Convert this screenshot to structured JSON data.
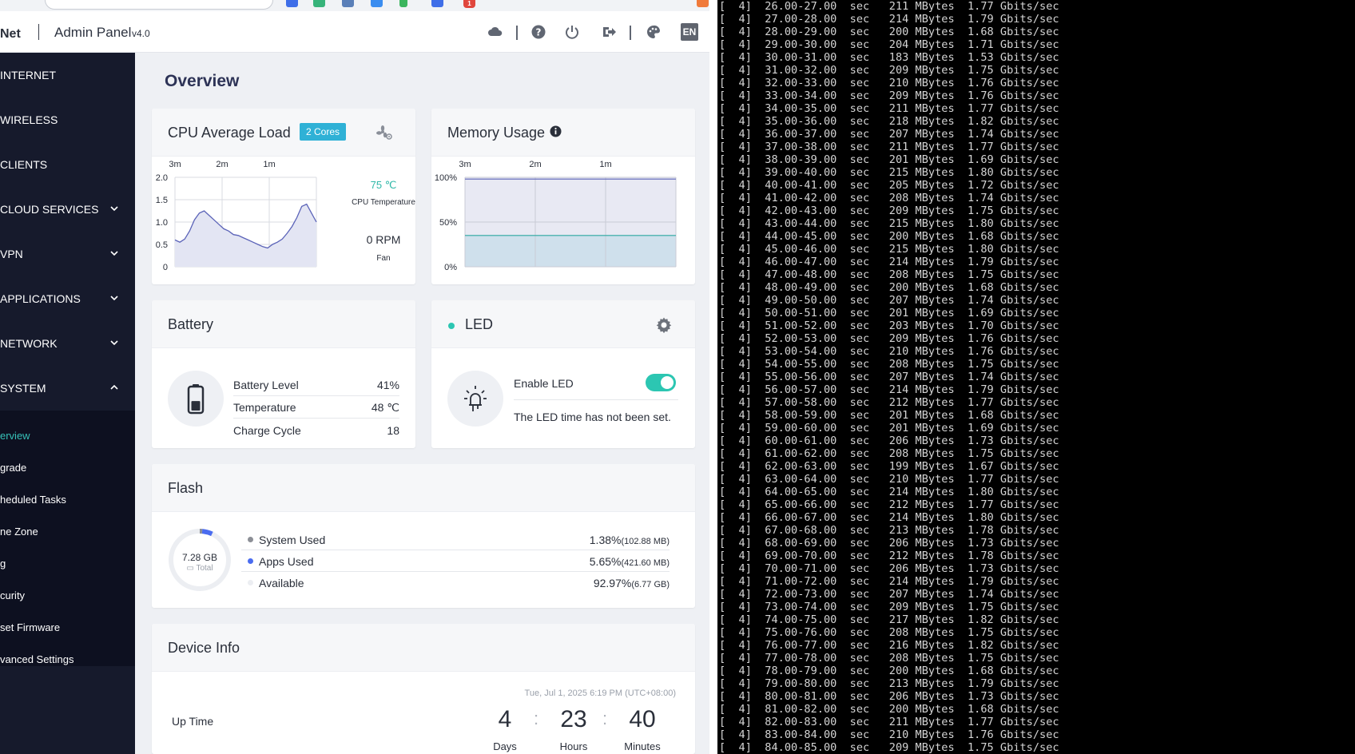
{
  "header": {
    "brand": "Net",
    "title": "Admin Panel",
    "version": "v4.0",
    "lang": "EN"
  },
  "sidebar": {
    "items": [
      {
        "label": "INTERNET",
        "expandable": false
      },
      {
        "label": "WIRELESS",
        "expandable": false
      },
      {
        "label": "CLIENTS",
        "expandable": false
      },
      {
        "label": "CLOUD SERVICES",
        "expandable": true
      },
      {
        "label": "VPN",
        "expandable": true
      },
      {
        "label": "APPLICATIONS",
        "expandable": true
      },
      {
        "label": "NETWORK",
        "expandable": true
      },
      {
        "label": "SYSTEM",
        "expandable": true
      }
    ],
    "system_submenu": [
      "erview",
      "grade",
      "heduled Tasks",
      "ne Zone",
      "g",
      "curity",
      "set Firmware",
      "vanced Settings"
    ],
    "active_submenu": "erview"
  },
  "main": {
    "title": "Overview",
    "cpu": {
      "title": "CPU Average Load",
      "cores_badge": "2 Cores",
      "temperature": "75 ℃",
      "temperature_label": "CPU Temperature",
      "fan_speed": "0 RPM",
      "fan_label": "Fan"
    },
    "memory": {
      "title": "Memory Usage"
    },
    "battery": {
      "title": "Battery",
      "rows": [
        {
          "label": "Battery Level",
          "value": "41%"
        },
        {
          "label": "Temperature",
          "value": "48 ℃"
        },
        {
          "label": "Charge Cycle",
          "value": "18"
        }
      ]
    },
    "led": {
      "title": "LED",
      "enable_label": "Enable LED",
      "enabled": true,
      "status": "The LED time has not been set."
    },
    "flash": {
      "title": "Flash",
      "total": "7.28 GB",
      "total_label": "Total",
      "rows": [
        {
          "label": "System Used",
          "percent": "1.38%",
          "size": "(102.88 MB)",
          "color": "#8c8f96"
        },
        {
          "label": "Apps Used",
          "percent": "5.65%",
          "size": "(421.60 MB)",
          "color": "#4a6cf0"
        },
        {
          "label": "Available",
          "percent": "92.97%",
          "size": "(6.77 GB)",
          "color": "#eceef2"
        }
      ]
    },
    "device_info": {
      "title": "Device Info",
      "date": "Tue, Jul 1, 2025 6:19 PM (UTC+08:00)",
      "uptime_label": "Up Time",
      "days": "4",
      "days_label": "Days",
      "hours": "23",
      "hours_label": "Hours",
      "minutes": "40",
      "minutes_label": "Minutes"
    }
  },
  "chart_data": [
    {
      "type": "area",
      "title": "CPU Average Load",
      "x_ticks": [
        "3m",
        "2m",
        "1m"
      ],
      "y_ticks": [
        "2.0",
        "1.5",
        "1.0",
        "0.5",
        "0"
      ],
      "ylim": [
        0,
        2.0
      ],
      "grid": true,
      "series": [
        {
          "values": [
            0.6,
            0.55,
            0.62,
            0.8,
            1.05,
            1.2,
            1.25,
            1.15,
            1.05,
            0.95,
            0.85,
            0.8,
            0.72,
            0.7,
            0.65,
            0.6,
            0.55,
            0.5,
            0.45,
            0.42,
            0.5,
            0.55,
            0.62,
            0.75,
            0.9,
            1.1,
            1.35,
            1.4,
            1.2,
            1.0
          ]
        }
      ],
      "color": "#5b63b8"
    },
    {
      "type": "area",
      "title": "Memory Usage",
      "x_ticks": [
        "3m",
        "2m",
        "1m"
      ],
      "y_ticks": [
        "100%",
        "50%",
        "0%"
      ],
      "ylim": [
        0,
        100
      ],
      "grid": true,
      "series": [
        {
          "values": [
            98,
            98,
            98,
            98,
            98,
            98
          ],
          "color": "#5b63b8"
        },
        {
          "values": [
            35,
            35,
            35,
            35,
            35,
            35
          ],
          "color": "#2aa8a0"
        }
      ]
    }
  ],
  "terminal": {
    "lines": [
      "[  4]  26.00-27.00  sec   211 MBytes  1.77 Gbits/sec",
      "[  4]  27.00-28.00  sec   214 MBytes  1.79 Gbits/sec",
      "[  4]  28.00-29.00  sec   200 MBytes  1.68 Gbits/sec",
      "[  4]  29.00-30.00  sec   204 MBytes  1.71 Gbits/sec",
      "[  4]  30.00-31.00  sec   183 MBytes  1.53 Gbits/sec",
      "[  4]  31.00-32.00  sec   209 MBytes  1.75 Gbits/sec",
      "[  4]  32.00-33.00  sec   210 MBytes  1.76 Gbits/sec",
      "[  4]  33.00-34.00  sec   209 MBytes  1.76 Gbits/sec",
      "[  4]  34.00-35.00  sec   211 MBytes  1.77 Gbits/sec",
      "[  4]  35.00-36.00  sec   218 MBytes  1.82 Gbits/sec",
      "[  4]  36.00-37.00  sec   207 MBytes  1.74 Gbits/sec",
      "[  4]  37.00-38.00  sec   211 MBytes  1.77 Gbits/sec",
      "[  4]  38.00-39.00  sec   201 MBytes  1.69 Gbits/sec",
      "[  4]  39.00-40.00  sec   215 MBytes  1.80 Gbits/sec",
      "[  4]  40.00-41.00  sec   205 MBytes  1.72 Gbits/sec",
      "[  4]  41.00-42.00  sec   208 MBytes  1.74 Gbits/sec",
      "[  4]  42.00-43.00  sec   209 MBytes  1.75 Gbits/sec",
      "[  4]  43.00-44.00  sec   215 MBytes  1.80 Gbits/sec",
      "[  4]  44.00-45.00  sec   200 MBytes  1.68 Gbits/sec",
      "[  4]  45.00-46.00  sec   215 MBytes  1.80 Gbits/sec",
      "[  4]  46.00-47.00  sec   214 MBytes  1.79 Gbits/sec",
      "[  4]  47.00-48.00  sec   208 MBytes  1.75 Gbits/sec",
      "[  4]  48.00-49.00  sec   200 MBytes  1.68 Gbits/sec",
      "[  4]  49.00-50.00  sec   207 MBytes  1.74 Gbits/sec",
      "[  4]  50.00-51.00  sec   201 MBytes  1.69 Gbits/sec",
      "[  4]  51.00-52.00  sec   203 MBytes  1.70 Gbits/sec",
      "[  4]  52.00-53.00  sec   209 MBytes  1.76 Gbits/sec",
      "[  4]  53.00-54.00  sec   210 MBytes  1.76 Gbits/sec",
      "[  4]  54.00-55.00  sec   208 MBytes  1.75 Gbits/sec",
      "[  4]  55.00-56.00  sec   207 MBytes  1.74 Gbits/sec",
      "[  4]  56.00-57.00  sec   214 MBytes  1.79 Gbits/sec",
      "[  4]  57.00-58.00  sec   212 MBytes  1.77 Gbits/sec",
      "[  4]  58.00-59.00  sec   201 MBytes  1.68 Gbits/sec",
      "[  4]  59.00-60.00  sec   201 MBytes  1.69 Gbits/sec",
      "[  4]  60.00-61.00  sec   206 MBytes  1.73 Gbits/sec",
      "[  4]  61.00-62.00  sec   208 MBytes  1.75 Gbits/sec",
      "[  4]  62.00-63.00  sec   199 MBytes  1.67 Gbits/sec",
      "[  4]  63.00-64.00  sec   210 MBytes  1.77 Gbits/sec",
      "[  4]  64.00-65.00  sec   214 MBytes  1.80 Gbits/sec",
      "[  4]  65.00-66.00  sec   212 MBytes  1.77 Gbits/sec",
      "[  4]  66.00-67.00  sec   214 MBytes  1.80 Gbits/sec",
      "[  4]  67.00-68.00  sec   213 MBytes  1.78 Gbits/sec",
      "[  4]  68.00-69.00  sec   206 MBytes  1.73 Gbits/sec",
      "[  4]  69.00-70.00  sec   212 MBytes  1.78 Gbits/sec",
      "[  4]  70.00-71.00  sec   206 MBytes  1.73 Gbits/sec",
      "[  4]  71.00-72.00  sec   214 MBytes  1.79 Gbits/sec",
      "[  4]  72.00-73.00  sec   207 MBytes  1.74 Gbits/sec",
      "[  4]  73.00-74.00  sec   209 MBytes  1.75 Gbits/sec",
      "[  4]  74.00-75.00  sec   217 MBytes  1.82 Gbits/sec",
      "[  4]  75.00-76.00  sec   208 MBytes  1.75 Gbits/sec",
      "[  4]  76.00-77.00  sec   216 MBytes  1.82 Gbits/sec",
      "[  4]  77.00-78.00  sec   208 MBytes  1.75 Gbits/sec",
      "[  4]  78.00-79.00  sec   200 MBytes  1.68 Gbits/sec",
      "[  4]  79.00-80.00  sec   213 MBytes  1.79 Gbits/sec",
      "[  4]  80.00-81.00  sec   206 MBytes  1.73 Gbits/sec",
      "[  4]  81.00-82.00  sec   200 MBytes  1.68 Gbits/sec",
      "[  4]  82.00-83.00  sec   211 MBytes  1.77 Gbits/sec",
      "[  4]  83.00-84.00  sec   210 MBytes  1.76 Gbits/sec",
      "[  4]  84.00-85.00  sec   209 MBytes  1.75 Gbits/sec"
    ]
  }
}
